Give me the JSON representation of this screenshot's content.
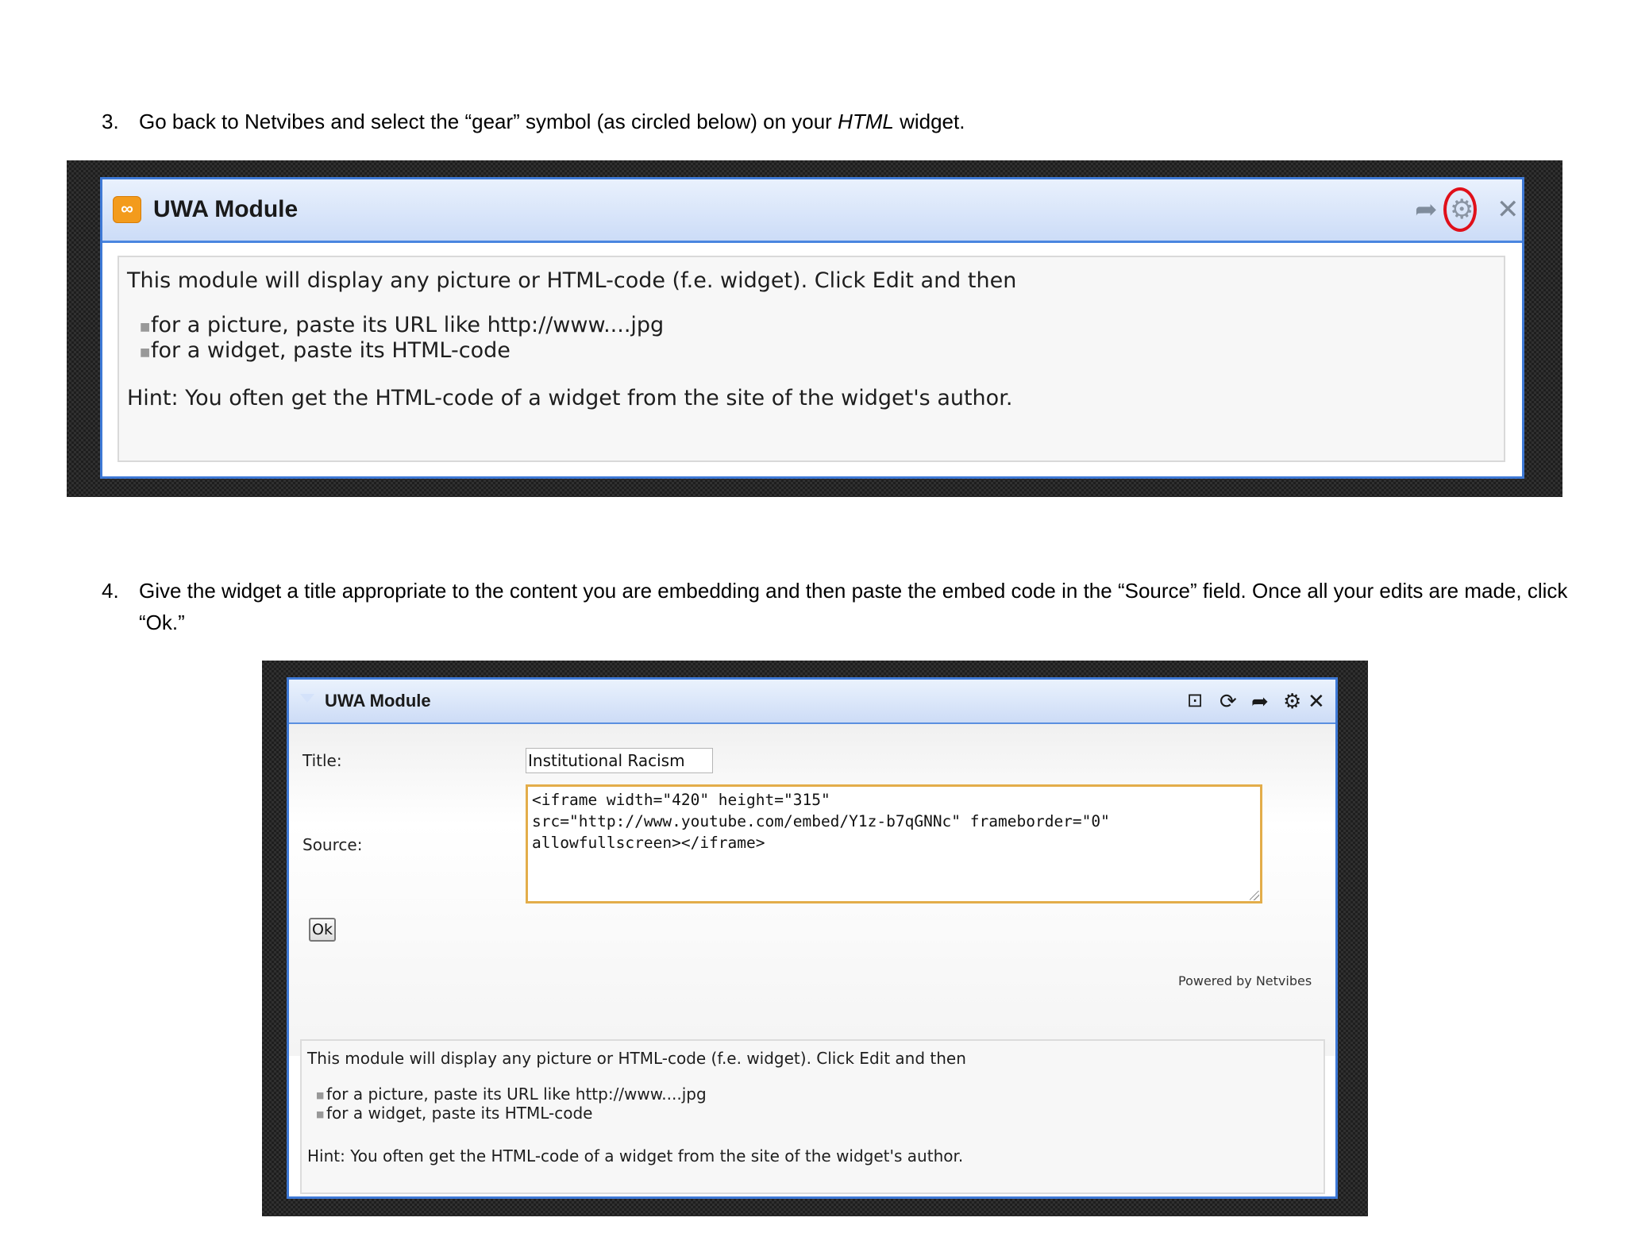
{
  "step3": {
    "number": "3.",
    "text_before": "Go back to Netvibes and select the “gear” symbol (as circled below) on your ",
    "text_emphasis": "HTML",
    "text_after": " widget."
  },
  "screenshot1": {
    "logo_glyph": "∞",
    "title": "UWA Module",
    "icons": [
      "share-icon",
      "gear-icon",
      "close-icon"
    ],
    "highlight_color": "#e0101a",
    "intro": "This module will display any picture or HTML-code (f.e. widget). Click Edit and then",
    "bullets": [
      "for a picture, paste its URL like http://www....jpg",
      "for a widget, paste its HTML-code"
    ],
    "hint": "Hint: You often get the HTML-code of a widget from the site of the widget's author."
  },
  "step4": {
    "number": "4.",
    "text": "Give the widget a title appropriate to the content you are embedding and then paste the embed code in the “Source” field. Once all your edits are made, click “Ok.”"
  },
  "screenshot2": {
    "title": "UWA Module",
    "toolbar_icons": [
      "minimize-icon",
      "refresh-icon",
      "share-icon",
      "gear-icon",
      "close-icon"
    ],
    "form": {
      "title_label": "Title:",
      "title_value": "Institutional Racism",
      "source_label": "Source:",
      "source_value": "<iframe width=\"420\" height=\"315\"\nsrc=\"http://www.youtube.com/embed/Y1z-b7qGNNc\" frameborder=\"0\"\nallowfullscreen></iframe>",
      "ok_label": "Ok"
    },
    "powered_by": "Powered by Netvibes",
    "intro": "This module will display any picture or HTML-code (f.e. widget). Click Edit and then",
    "bullets": [
      "for a picture, paste its URL like http://www....jpg",
      "for a widget, paste its HTML-code"
    ],
    "hint": "Hint: You often get the HTML-code of a widget from the site of the widget's author."
  }
}
